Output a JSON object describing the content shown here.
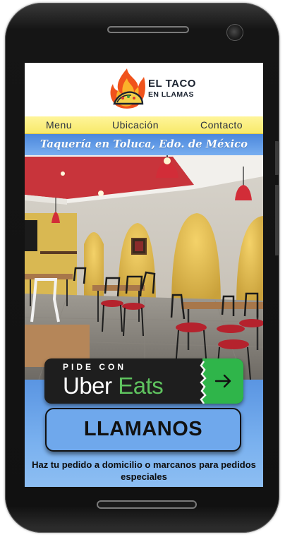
{
  "brand": {
    "title_line1": "EL TACO",
    "title_line2": "EN LLAMAS",
    "colors": {
      "flame_outer": "#f0531c",
      "flame_inner": "#fbb22a",
      "text": "#1b2330"
    }
  },
  "nav": {
    "items": [
      {
        "label": "Menu"
      },
      {
        "label": "Ubicación"
      },
      {
        "label": "Contacto"
      }
    ],
    "background": "#f7e96a"
  },
  "tagline": {
    "text": "Taquería en Toluca, Edo. de México"
  },
  "hero_photo": {
    "alt_icon": "restaurant-interior-photo"
  },
  "uber_eats": {
    "pre_label": "PIDE CON",
    "brand_uber": "Uber",
    "brand_eats": "Eats",
    "arrow_icon": "arrow-right-icon",
    "accent_color": "#2fb54a"
  },
  "call": {
    "label": "LLAMANOS"
  },
  "note": {
    "text": "Haz tu pedido a domicilio o marcanos para pedidos especiales"
  },
  "theme": {
    "accent_blue": "#6fa8ec",
    "tagline_blue": "#5a95e2"
  }
}
